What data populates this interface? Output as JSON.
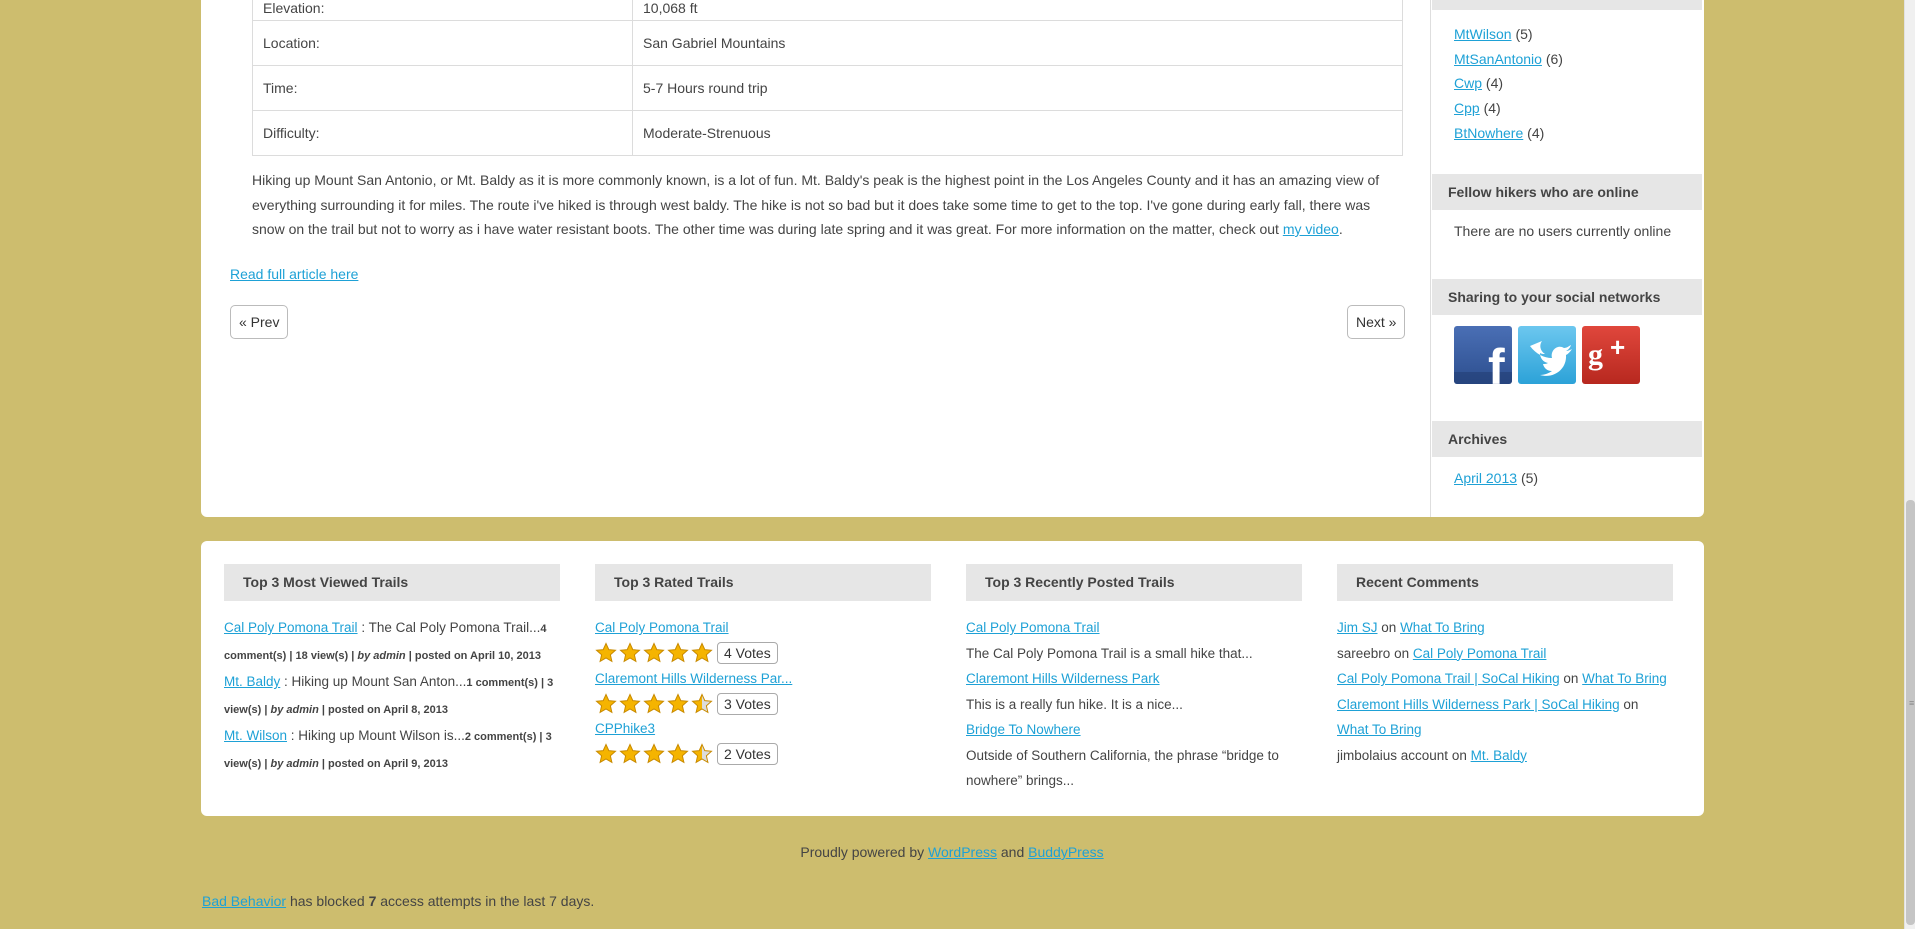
{
  "info_table": [
    {
      "label": "Elevation:",
      "value": "10,068 ft"
    },
    {
      "label": "Location:",
      "value": "San Gabriel Mountains"
    },
    {
      "label": "Time:",
      "value": "5-7 Hours round trip"
    },
    {
      "label": "Difficulty:",
      "value": "Moderate-Strenuous"
    }
  ],
  "article": {
    "text": "Hiking up Mount San Antonio, or Mt. Baldy as it is more commonly known, is a lot of fun. Mt. Baldy's peak is the highest point in the Los Angeles County and it has an amazing view of everything surrounding it for miles. The route i've hiked is through west baldy. The hike is not so bad but it does take some time to get to the top. I've gone during early fall, there was snow on the trail but not to worry as i have water resistant boots. The other time was during late spring and it was great.  For more information on the matter, check out ",
    "video_link": "my video",
    "end": ".",
    "read_full": "Read full article here"
  },
  "pager": {
    "prev": "« Prev",
    "next": "Next »"
  },
  "sidebar": {
    "categories": [
      {
        "name": "MtWilson",
        "count": "(5)"
      },
      {
        "name": "MtSanAntonio",
        "count": "(6)"
      },
      {
        "name": "Cwp",
        "count": "(4)"
      },
      {
        "name": "Cpp",
        "count": "(4)"
      },
      {
        "name": "BtNowhere",
        "count": "(4)"
      }
    ],
    "online_title": "Fellow hikers who are online",
    "online_text": "There are no users currently online",
    "sharing_title": "Sharing to your social networks",
    "social": [
      "facebook-icon",
      "twitter-icon",
      "google-plus-icon"
    ],
    "archives_title": "Archives",
    "archive_link": "April 2013",
    "archive_count": "(5)"
  },
  "widgets": {
    "most_viewed": {
      "title": "Top 3 Most Viewed Trails",
      "items": [
        {
          "link": "Cal Poly Pomona Trail",
          "excerpt": " : The Cal Poly Pomona Trail...",
          "comments": "4 comment(s)",
          "views": "18 view(s)",
          "by": "by admin",
          "posted": "posted on April 10, 2013"
        },
        {
          "link": "Mt. Baldy",
          "excerpt": " : Hiking up Mount San Anton...",
          "comments": "1 comment(s)",
          "views": "3 view(s)",
          "by": "by admin",
          "posted": "posted on April 8, 2013"
        },
        {
          "link": "Mt. Wilson",
          "excerpt": " : Hiking up Mount Wilson is...",
          "comments": "2 comment(s)",
          "views": "3 view(s)",
          "by": "by admin",
          "posted": "posted on April 9, 2013"
        }
      ]
    },
    "top_rated": {
      "title": "Top 3 Rated Trails",
      "items": [
        {
          "link": "Cal Poly Pomona Trail",
          "stars": 5,
          "votes": "4 Votes"
        },
        {
          "link": "Claremont Hills Wilderness Par...",
          "stars": 4.5,
          "votes": "3 Votes"
        },
        {
          "link": "CPPhike3",
          "stars": 4.5,
          "votes": "2 Votes"
        }
      ]
    },
    "recent_posted": {
      "title": "Top 3 Recently Posted Trails",
      "items": [
        {
          "link": "Cal Poly Pomona Trail",
          "excerpt": "The Cal Poly Pomona Trail is a small hike that..."
        },
        {
          "link": "Claremont Hills Wilderness Park",
          "excerpt": "This is a really fun hike. It is a nice..."
        },
        {
          "link": "Bridge To Nowhere",
          "excerpt": "Outside of Southern California, the phrase “bridge to nowhere” brings..."
        }
      ]
    },
    "recent_comments": {
      "title": "Recent Comments",
      "items": [
        {
          "author": "Jim SJ",
          "author_link": true,
          "on": "on",
          "post": "What To Bring"
        },
        {
          "author": "sareebro",
          "author_link": false,
          "on": "on",
          "post": "Cal Poly Pomona Trail"
        },
        {
          "author": "Cal Poly Pomona Trail | SoCal Hiking",
          "author_link": true,
          "on": "on",
          "post": "What To Bring"
        },
        {
          "author": "Claremont Hills Wilderness Park | SoCal Hiking",
          "author_link": true,
          "on": "on",
          "post": "What To Bring"
        },
        {
          "author": "jimbolaius account",
          "author_link": false,
          "on": "on",
          "post": "Mt. Baldy"
        }
      ]
    }
  },
  "credits": {
    "prefix": "Proudly powered by ",
    "wordpress": "WordPress",
    "and": " and ",
    "buddypress": "BuddyPress"
  },
  "bad_behavior": {
    "link": "Bad Behavior",
    "text1": " has blocked ",
    "count": "7",
    "text2": " access attempts in the last 7 days."
  },
  "colors": {
    "background": "#cdbd6e",
    "link": "#1ea1d6",
    "header_bg": "#e6e6e6"
  }
}
